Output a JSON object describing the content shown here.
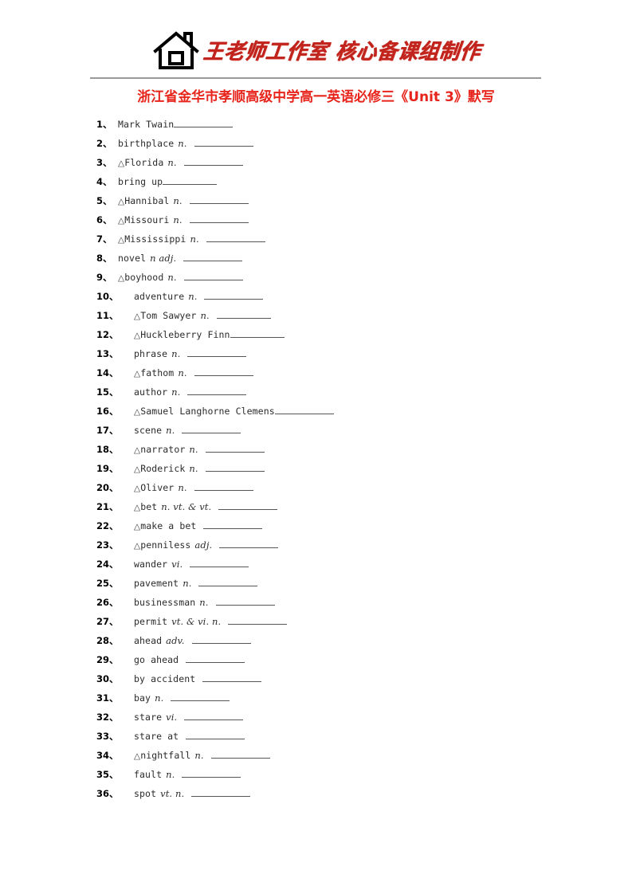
{
  "header": {
    "icon": "house-icon",
    "logo_text": "王老师工作室 核心备课组制作"
  },
  "title": "浙江省金华市孝顺高级中学高一英语必修三《Unit 3》默写",
  "colors": {
    "logo_red": "#c0241c",
    "title_red": "#e8251c",
    "rule_gray": "#9a9a9a",
    "text_black": "#1a1a1a"
  },
  "items": [
    {
      "num": "1、",
      "marker": "",
      "word": "Mark Twain",
      "pos": "",
      "blank": "w3",
      "tight": true
    },
    {
      "num": "2、",
      "marker": "",
      "word": "birthplace",
      "pos": "n.",
      "blank": "w3",
      "tight": false
    },
    {
      "num": "3、",
      "marker": "△",
      "word": "Florida",
      "pos": "n.",
      "blank": "w3",
      "tight": false
    },
    {
      "num": "4、",
      "marker": "",
      "word": "bring up",
      "pos": "",
      "blank": "w2",
      "tight": true
    },
    {
      "num": "5、",
      "marker": "△",
      "word": "Hannibal",
      "pos": "n.",
      "blank": "w3",
      "tight": false
    },
    {
      "num": "6、",
      "marker": "△",
      "word": "Missouri",
      "pos": "n.",
      "blank": "w3",
      "tight": false
    },
    {
      "num": "7、",
      "marker": "△",
      "word": "Mississippi",
      "pos": "n.",
      "blank": "w3",
      "tight": false
    },
    {
      "num": "8、",
      "marker": "",
      "word": "novel",
      "pos": "n adj.",
      "blank": "w3",
      "tight": false
    },
    {
      "num": "9、",
      "marker": "△",
      "word": "boyhood",
      "pos": "n.",
      "blank": "w3",
      "tight": false
    },
    {
      "num": "10、",
      "marker": "",
      "word": "adventure",
      "pos": "n.",
      "blank": "w3",
      "tight": false
    },
    {
      "num": "11、",
      "marker": "△",
      "word": "Tom Sawyer",
      "pos": "n.",
      "blank": "w2",
      "tight": false
    },
    {
      "num": "12、",
      "marker": "△",
      "word": "Huckleberry Finn",
      "pos": "",
      "blank": "w2",
      "tight": true
    },
    {
      "num": "13、",
      "marker": "",
      "word": "phrase",
      "pos": "n.",
      "blank": "w3",
      "tight": false
    },
    {
      "num": "14、",
      "marker": "△",
      "word": "fathom",
      "pos": "n.",
      "blank": "w3",
      "tight": false
    },
    {
      "num": "15、",
      "marker": "",
      "word": "author",
      "pos": "n.",
      "blank": "w3",
      "tight": false
    },
    {
      "num": "16、",
      "marker": "△",
      "word": "Samuel Langhorne Clemens",
      "pos": "",
      "blank": "w3",
      "tight": true
    },
    {
      "num": "17、",
      "marker": "",
      "word": "scene",
      "pos": "n.",
      "blank": "w3",
      "tight": false
    },
    {
      "num": "18、",
      "marker": "△",
      "word": "narrator",
      "pos": "n.",
      "blank": "w3",
      "tight": false
    },
    {
      "num": "19、",
      "marker": "△",
      "word": "Roderick",
      "pos": "n.",
      "blank": "w3",
      "tight": false
    },
    {
      "num": "20、",
      "marker": "△",
      "word": "Oliver",
      "pos": "n.",
      "blank": "w3",
      "tight": false
    },
    {
      "num": "21、",
      "marker": "△",
      "word": "bet",
      "pos": "n.   vt. & vt.",
      "blank": "w3",
      "tight": false
    },
    {
      "num": "22、",
      "marker": "△",
      "word": "make a bet",
      "pos": "",
      "blank": "w3",
      "tight": false
    },
    {
      "num": "23、",
      "marker": "△",
      "word": "penniless",
      "pos": "adj.",
      "blank": "w3",
      "tight": false
    },
    {
      "num": "24、",
      "marker": "",
      "word": "wander",
      "pos": "vi.",
      "blank": "w3",
      "tight": false
    },
    {
      "num": "25、",
      "marker": "",
      "word": "pavement",
      "pos": "n.",
      "blank": "w3",
      "tight": false
    },
    {
      "num": "26、",
      "marker": "",
      "word": "businessman",
      "pos": "n.",
      "blank": "w3",
      "tight": false
    },
    {
      "num": "27、",
      "marker": "",
      "word": "permit",
      "pos": "vt. & vi. n.",
      "blank": "w3",
      "tight": false
    },
    {
      "num": "28、",
      "marker": "",
      "word": "ahead",
      "pos": "adv.",
      "blank": "w3",
      "tight": false
    },
    {
      "num": "29、",
      "marker": "",
      "word": "go ahead",
      "pos": "",
      "blank": "w3",
      "tight": false
    },
    {
      "num": "30、",
      "marker": "",
      "word": "by accident",
      "pos": "",
      "blank": "w3",
      "tight": false
    },
    {
      "num": "31、",
      "marker": "",
      "word": "bay",
      "pos": "n.",
      "blank": "w3",
      "tight": false
    },
    {
      "num": "32、",
      "marker": "",
      "word": "stare",
      "pos": "vi.",
      "blank": "w3",
      "tight": false
    },
    {
      "num": "33、",
      "marker": "",
      "word": "stare at",
      "pos": "",
      "blank": "w3",
      "tight": false
    },
    {
      "num": "34、",
      "marker": "△",
      "word": "nightfall",
      "pos": "n.",
      "blank": "w3",
      "tight": false
    },
    {
      "num": "35、",
      "marker": "",
      "word": "fault",
      "pos": "n.",
      "blank": "w3",
      "tight": false
    },
    {
      "num": "36、",
      "marker": "",
      "word": "spot",
      "pos": "vt. n.",
      "blank": "w3",
      "tight": false
    }
  ]
}
